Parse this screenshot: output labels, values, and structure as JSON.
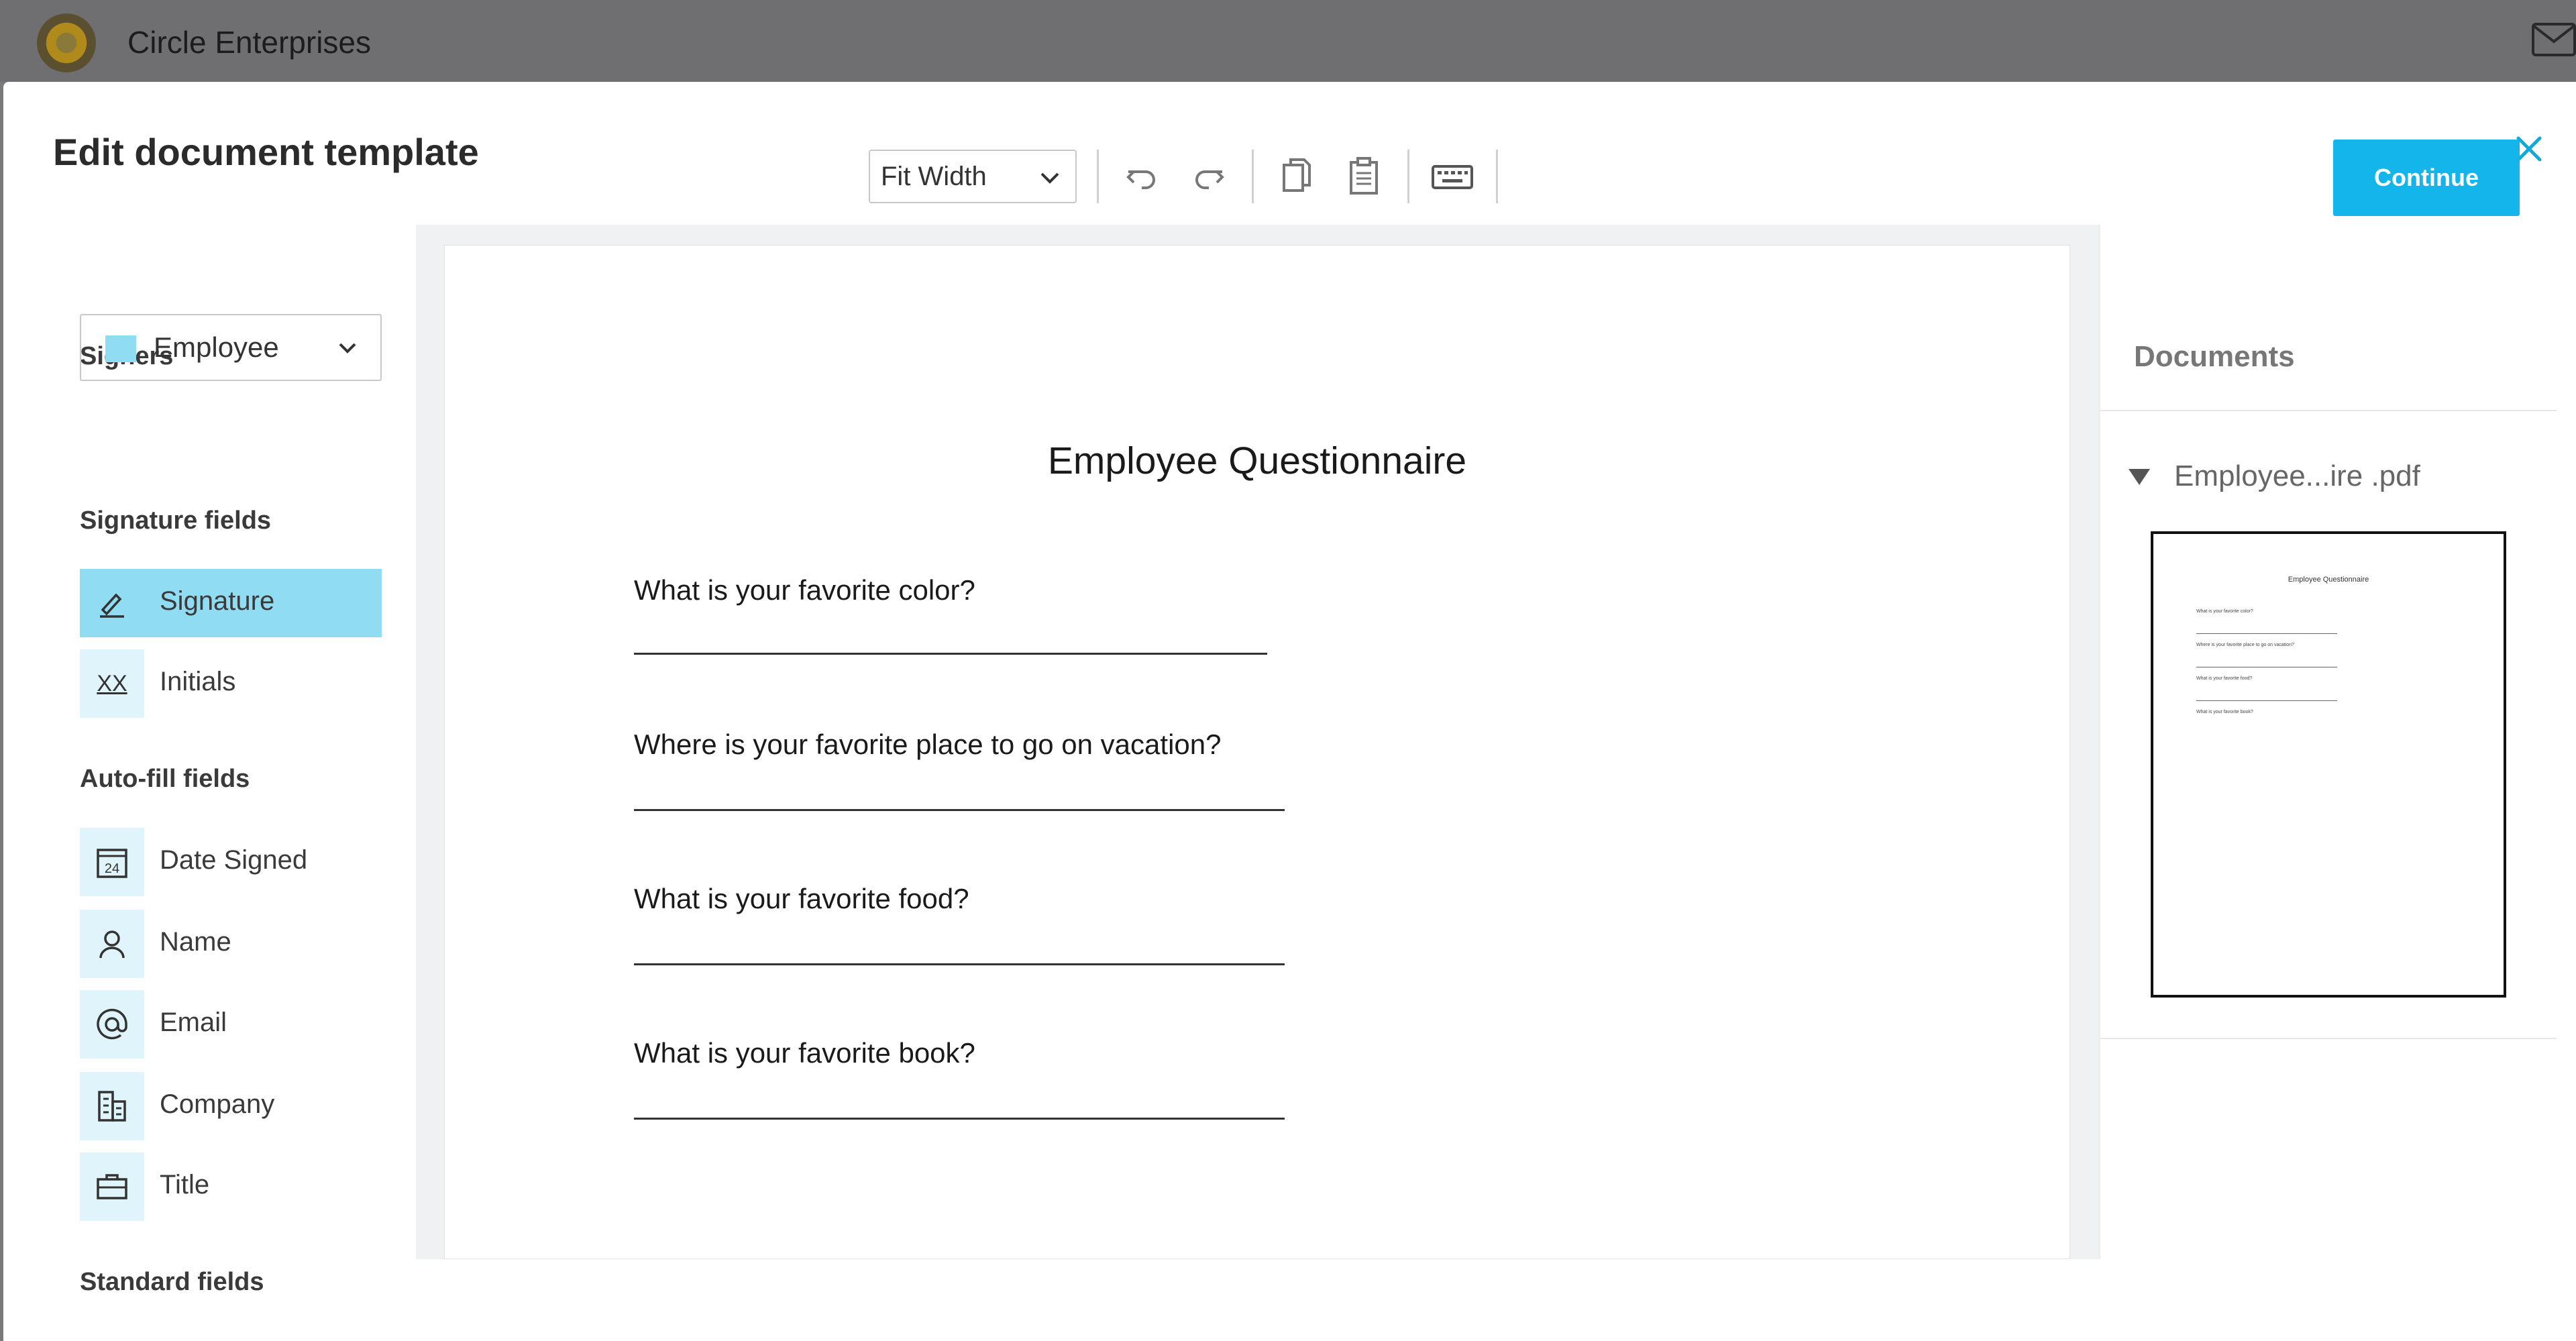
{
  "app": {
    "name": "Circle Enterprises",
    "mail_icon": "mail-icon"
  },
  "modal": {
    "title": "Edit document template",
    "close_icon": "close-icon"
  },
  "toolbar": {
    "zoom_value": "Fit Width",
    "zoom_icon": "chevron-down-icon",
    "buttons": [
      "undo-icon",
      "redo-icon",
      "copy-icon",
      "paste-icon",
      "keyboard-icon"
    ],
    "continue_label": "Continue",
    "accent": "#13b5ea"
  },
  "sidebar": {
    "signers_label": "Signers",
    "signer_selected": "Employee",
    "signer_color": "#8fdcf3",
    "signature_fields_label": "Signature fields",
    "signature_fields": [
      {
        "label": "Signature",
        "icon": "pen-icon",
        "active": true
      },
      {
        "label": "Initials",
        "icon": "initials-icon",
        "icon_text": "XX",
        "active": false
      }
    ],
    "autofill_label": "Auto-fill fields",
    "autofill_fields": [
      {
        "label": "Date Signed",
        "icon": "calendar-icon",
        "icon_text": "24"
      },
      {
        "label": "Name",
        "icon": "person-icon"
      },
      {
        "label": "Email",
        "icon": "at-sign-icon"
      },
      {
        "label": "Company",
        "icon": "building-icon"
      },
      {
        "label": "Title",
        "icon": "briefcase-icon"
      }
    ],
    "standard_label": "Standard fields"
  },
  "document": {
    "title": "Employee Questionnaire",
    "questions": [
      "What is your favorite color?",
      "Where is your favorite place to go on vacation?",
      "What is your favorite food?",
      "What is your favorite book?"
    ]
  },
  "documents_panel": {
    "title": "Documents",
    "file_name": "Employee...ire .pdf",
    "expand_icon": "triangle-down-icon",
    "thumbnail": {
      "title": "Employee Questionnaire",
      "questions": [
        "What is your favorite color?",
        "Where is your favorite place to go on vacation?",
        "What is your favorite food?",
        "What is your favorite book?"
      ]
    }
  }
}
